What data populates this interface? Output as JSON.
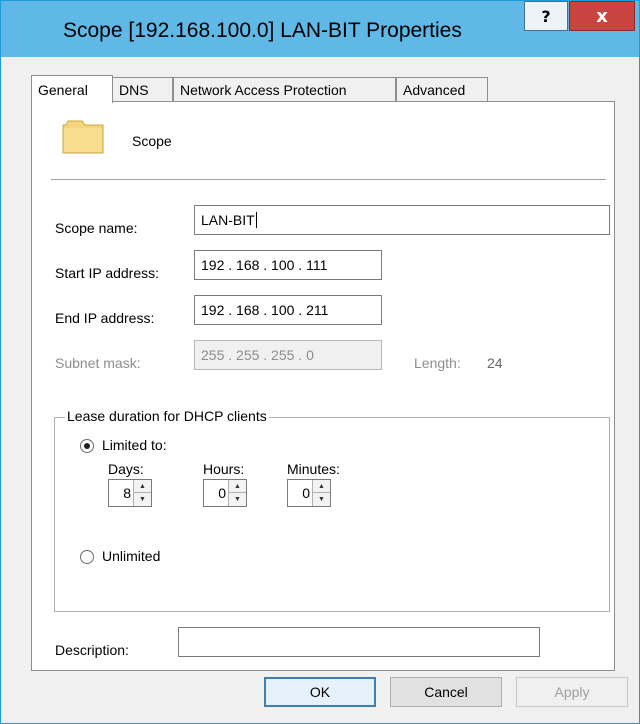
{
  "window": {
    "title": "Scope [192.168.100.0] LAN-BIT Properties",
    "help_label": "?",
    "close_label": "x"
  },
  "tabs": [
    {
      "label": "General",
      "active": true
    },
    {
      "label": "DNS",
      "active": false
    },
    {
      "label": "Network Access Protection",
      "active": false
    },
    {
      "label": "Advanced",
      "active": false
    }
  ],
  "general": {
    "header_label": "Scope",
    "scope_name_label": "Scope name:",
    "scope_name_value": "LAN-BIT",
    "start_ip_label": "Start IP address:",
    "start_ip_value": "192 . 168 . 100 . 111",
    "end_ip_label": "End IP address:",
    "end_ip_value": "192 . 168 . 100 . 211",
    "subnet_mask_label": "Subnet mask:",
    "subnet_mask_value": "255 . 255 . 255 .  0",
    "length_label": "Length:",
    "length_value": "24",
    "lease": {
      "group_title": "Lease duration for DHCP clients",
      "limited_label": "Limited to:",
      "limited_selected": true,
      "days_label": "Days:",
      "days_value": "8",
      "hours_label": "Hours:",
      "hours_value": "0",
      "minutes_label": "Minutes:",
      "minutes_value": "0",
      "unlimited_label": "Unlimited"
    },
    "description_label": "Description:",
    "description_value": ""
  },
  "buttons": {
    "ok_label": "OK",
    "cancel_label": "Cancel",
    "apply_label": "Apply"
  },
  "colors": {
    "titlebar": "#5fb8e5",
    "close_button": "#c8453f",
    "window_border": "#1d9bdb"
  }
}
